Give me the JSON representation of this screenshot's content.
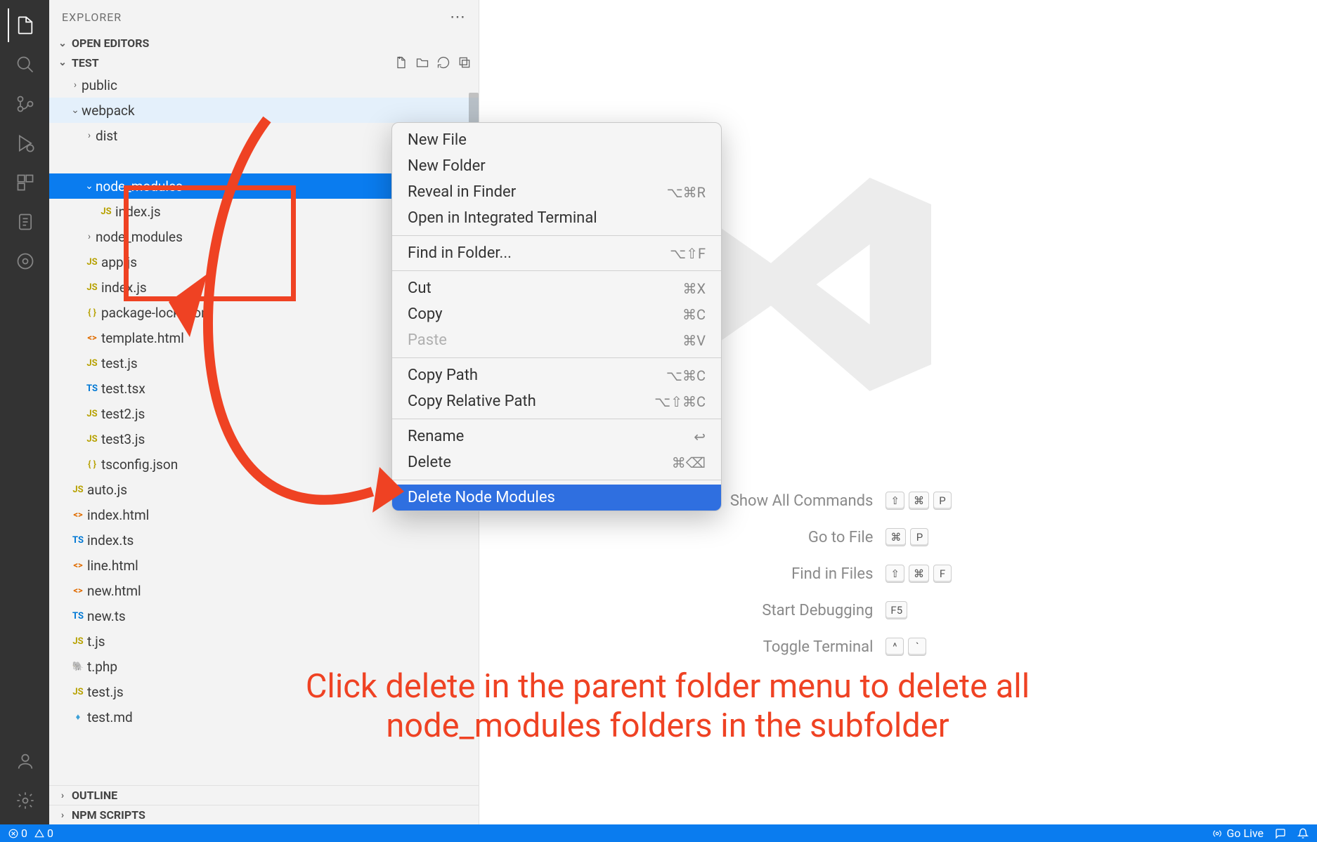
{
  "sidebar": {
    "title": "EXPLORER",
    "open_editors": "OPEN EDITORS",
    "workspace": "TEST",
    "outline": "OUTLINE",
    "npm_scripts": "NPM SCRIPTS",
    "tree": {
      "public": "public",
      "webpack": "webpack",
      "dist": "dist",
      "node_modules_1": "node_modules",
      "index_js_inner": "index.js",
      "node_modules_2": "node_modules",
      "app_js": "app.js",
      "index_js": "index.js",
      "package_lock": "package-lock.json",
      "template_html": "template.html",
      "test_js": "test.js",
      "test_tsx": "test.tsx",
      "test2_js": "test2.js",
      "test3_js": "test3.js",
      "tsconfig": "tsconfig.json",
      "auto_js": "auto.js",
      "index_html": "index.html",
      "index_ts": "index.ts",
      "line_html": "line.html",
      "new_html": "new.html",
      "new_ts": "new.ts",
      "t_js": "t.js",
      "t_php": "t.php",
      "test_js2": "test.js",
      "test_md": "test.md"
    }
  },
  "context_menu": {
    "new_file": "New File",
    "new_folder": "New Folder",
    "reveal": "Reveal in Finder",
    "reveal_sc": "⌥⌘R",
    "open_terminal": "Open in Integrated Terminal",
    "find_folder": "Find in Folder...",
    "find_folder_sc": "⌥⇧F",
    "cut": "Cut",
    "cut_sc": "⌘X",
    "copy": "Copy",
    "copy_sc": "⌘C",
    "paste": "Paste",
    "paste_sc": "⌘V",
    "copy_path": "Copy Path",
    "copy_path_sc": "⌥⌘C",
    "copy_rel": "Copy Relative Path",
    "copy_rel_sc": "⌥⇧⌘C",
    "rename": "Rename",
    "rename_sc": "↩",
    "delete": "Delete",
    "delete_sc": "⌘⌫",
    "delete_nm": "Delete Node Modules"
  },
  "welcome": {
    "show_all": "Show All Commands",
    "show_all_keys": [
      "⇧",
      "⌘",
      "P"
    ],
    "go_file": "Go to File",
    "go_file_keys": [
      "⌘",
      "P"
    ],
    "find_files": "Find in Files",
    "find_files_keys": [
      "⇧",
      "⌘",
      "F"
    ],
    "debug": "Start Debugging",
    "debug_keys": [
      "F5"
    ],
    "toggle_term": "Toggle Terminal",
    "toggle_term_keys": [
      "^",
      "`"
    ]
  },
  "annotation": {
    "line1": "Click delete in the parent folder menu to delete all",
    "line2": "node_modules folders in the subfolder"
  },
  "status": {
    "errors": "0",
    "warnings": "0",
    "golive": "Go Live"
  }
}
